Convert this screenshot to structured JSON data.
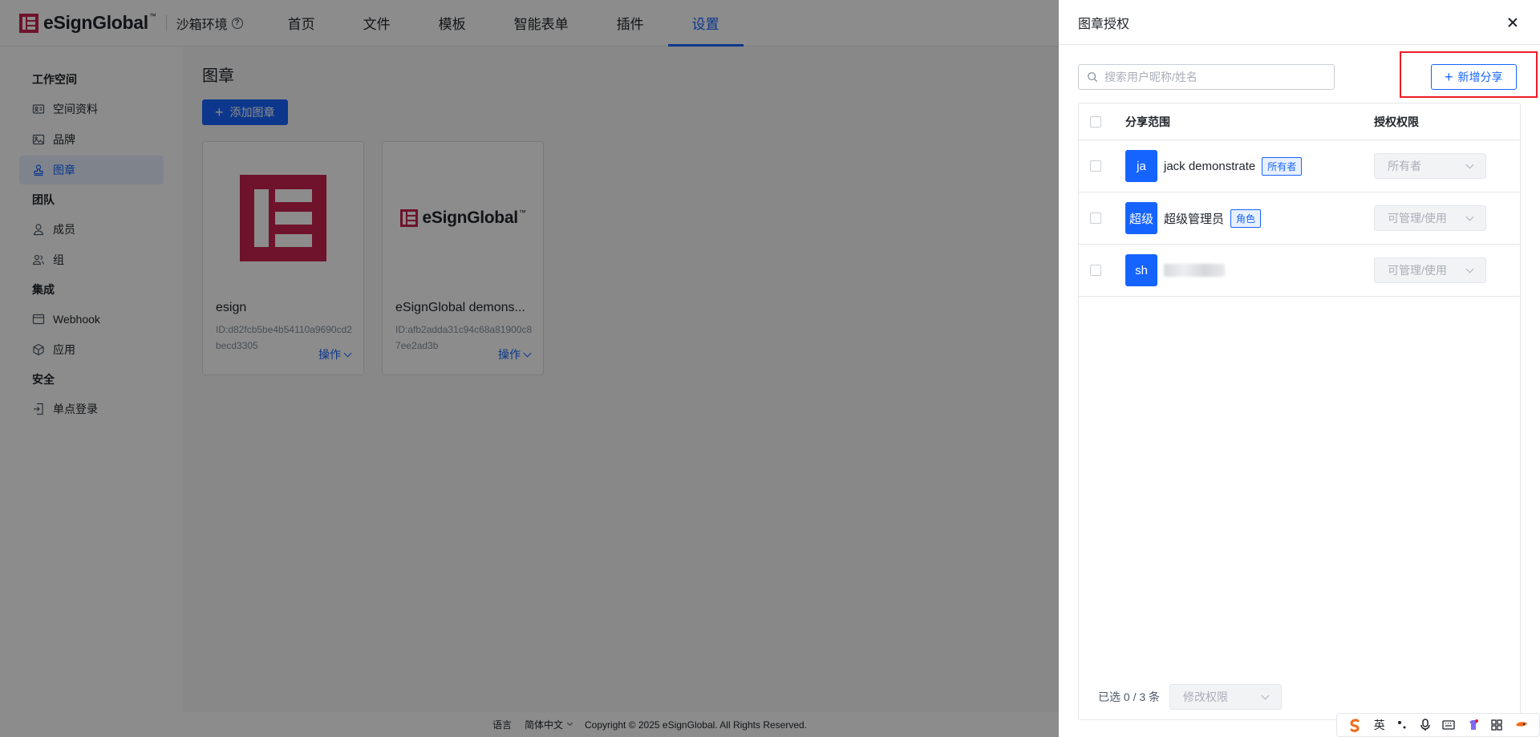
{
  "brand": {
    "name": "eSignGlobal",
    "tm": "™"
  },
  "env": {
    "label": "沙箱环境"
  },
  "nav": {
    "tabs": [
      "首页",
      "文件",
      "模板",
      "智能表单",
      "插件",
      "设置"
    ],
    "active": "设置"
  },
  "sidebar": {
    "groups": [
      {
        "title": "工作空间",
        "items": [
          {
            "label": "空间资料",
            "icon": "id-card-icon"
          },
          {
            "label": "品牌",
            "icon": "image-icon"
          },
          {
            "label": "图章",
            "icon": "stamp-icon",
            "active": true
          }
        ]
      },
      {
        "title": "团队",
        "items": [
          {
            "label": "成员",
            "icon": "user-icon"
          },
          {
            "label": "组",
            "icon": "users-icon"
          }
        ]
      },
      {
        "title": "集成",
        "items": [
          {
            "label": "Webhook",
            "icon": "window-icon"
          },
          {
            "label": "应用",
            "icon": "cube-icon"
          }
        ]
      },
      {
        "title": "安全",
        "items": [
          {
            "label": "单点登录",
            "icon": "login-icon"
          }
        ]
      }
    ]
  },
  "main": {
    "title": "图章",
    "add_button": "添加图章",
    "seals": [
      {
        "name": "esign",
        "id": "ID:d82fcb5be4b54110a9690cd2becd3305",
        "op": "操作"
      },
      {
        "name": "eSignGlobal demons...",
        "id": "ID:afb2adda31c94c68a81900c87ee2ad3b",
        "op": "操作"
      }
    ]
  },
  "footer": {
    "lang_label": "语言",
    "lang_value": "简体中文",
    "copyright": "Copyright © 2025 eSignGlobal. All Rights Reserved."
  },
  "drawer": {
    "title": "图章授权",
    "search_placeholder": "搜索用户昵称/姓名",
    "add_share": "新增分享",
    "columns": {
      "scope": "分享范围",
      "perm": "授权权限"
    },
    "rows": [
      {
        "avatar": "ja",
        "name": "jack demonstrate",
        "tag": "所有者",
        "perm": "所有者"
      },
      {
        "avatar": "超级",
        "name": "超级管理员",
        "tag": "角色",
        "perm": "可管理/使用"
      },
      {
        "avatar": "sh",
        "name": "",
        "tag": "",
        "perm": "可管理/使用"
      }
    ],
    "selected_text": "已选 0 / 3 条",
    "bulk_label": "修改权限"
  },
  "ime": {
    "lang": "英"
  },
  "colors": {
    "primary": "#1664ff",
    "brand": "#c8234f",
    "highlight": "#ee1c25"
  }
}
